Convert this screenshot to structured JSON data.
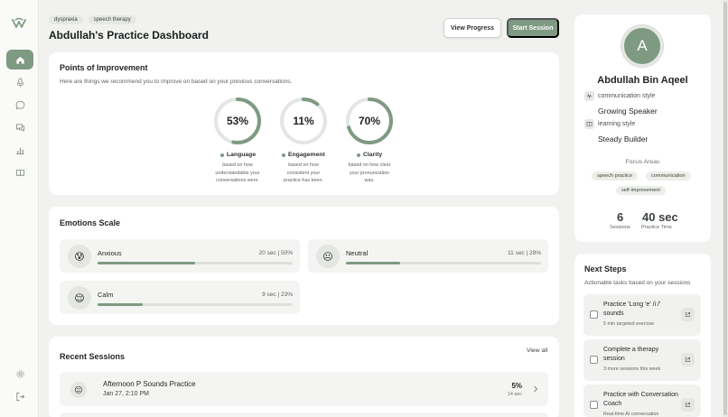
{
  "header": {
    "tags": [
      "dyspraxia",
      "speech therapy"
    ],
    "title": "Abdullah's Practice Dashboard",
    "view_progress": "View Progress",
    "start_session": "Start Session"
  },
  "sidebar": {
    "items": [
      {
        "name": "home",
        "icon": "home-icon",
        "active": true
      },
      {
        "name": "microphone",
        "icon": "mic-icon"
      },
      {
        "name": "chat",
        "icon": "chat-icon"
      },
      {
        "name": "messages",
        "icon": "messages-icon"
      },
      {
        "name": "analytics",
        "icon": "bar-chart-icon"
      },
      {
        "name": "library",
        "icon": "book-icon"
      },
      {
        "name": "settings",
        "icon": "gear-icon"
      },
      {
        "name": "logout",
        "icon": "logout-icon"
      }
    ]
  },
  "improvement": {
    "title": "Points of Improvement",
    "subtitle": "Here are things we recommend you to improve on based on your previous conversations.",
    "metrics": [
      {
        "percent_label": "53%",
        "percent": 53,
        "label": "Language",
        "desc": [
          "based on how",
          "understandable your",
          "conversations were."
        ]
      },
      {
        "percent_label": "11%",
        "percent": 11,
        "label": "Engagement",
        "desc": [
          "based on how",
          "consistent your",
          "practice has been."
        ]
      },
      {
        "percent_label": "70%",
        "percent": 70,
        "label": "Clarity",
        "desc": [
          "based on how clear",
          "your pronunciation",
          "was."
        ]
      }
    ]
  },
  "emotions": {
    "title": "Emotions Scale",
    "items": [
      {
        "name": "Anxious",
        "value": "20 sec | 50%",
        "percent": 50,
        "emoji": "😰"
      },
      {
        "name": "Neutral",
        "value": "11 sec | 28%",
        "percent": 28,
        "emoji": "😐"
      },
      {
        "name": "Calm",
        "value": "9 sec | 23%",
        "percent": 23,
        "emoji": "😌"
      }
    ]
  },
  "recent": {
    "title": "Recent Sessions",
    "view_all": "View all",
    "sessions": [
      {
        "title": "Afternoon P Sounds Practice",
        "date": "Jan 27, 2:10 PM",
        "percent": "5%",
        "duration": "14 sec",
        "emoji": "😐"
      }
    ]
  },
  "profile": {
    "initial": "A",
    "name": "Abdullah Bin Aqeel",
    "communication_label": "communication style",
    "communication_value": "Growing Speaker",
    "learning_label": "learning style",
    "learning_value": "Steady Builder",
    "focus_title": "Focus Areas",
    "focus_areas": [
      "speech practice",
      "communication",
      "self-improvement"
    ],
    "sessions_count": "6",
    "sessions_label": "Sessions",
    "practice_time": "40 sec",
    "practice_label": "Practice Time"
  },
  "next_steps": {
    "title": "Next Steps",
    "subtitle": "Actionable tasks based on your sessions",
    "items": [
      {
        "title": [
          "Practice 'Long 'e' /iː/'",
          "sounds"
        ],
        "meta": "5 min targeted exercise"
      },
      {
        "title": [
          "Complete a therapy",
          "session"
        ],
        "meta": "3 more sessions this week"
      },
      {
        "title": [
          "Practice with Conversation",
          "Coach"
        ],
        "meta": "Real-time AI conversation"
      }
    ]
  },
  "colors": {
    "accent": "#7f9a82",
    "track": "#e3e6e2",
    "background": "#f1f2f0"
  }
}
